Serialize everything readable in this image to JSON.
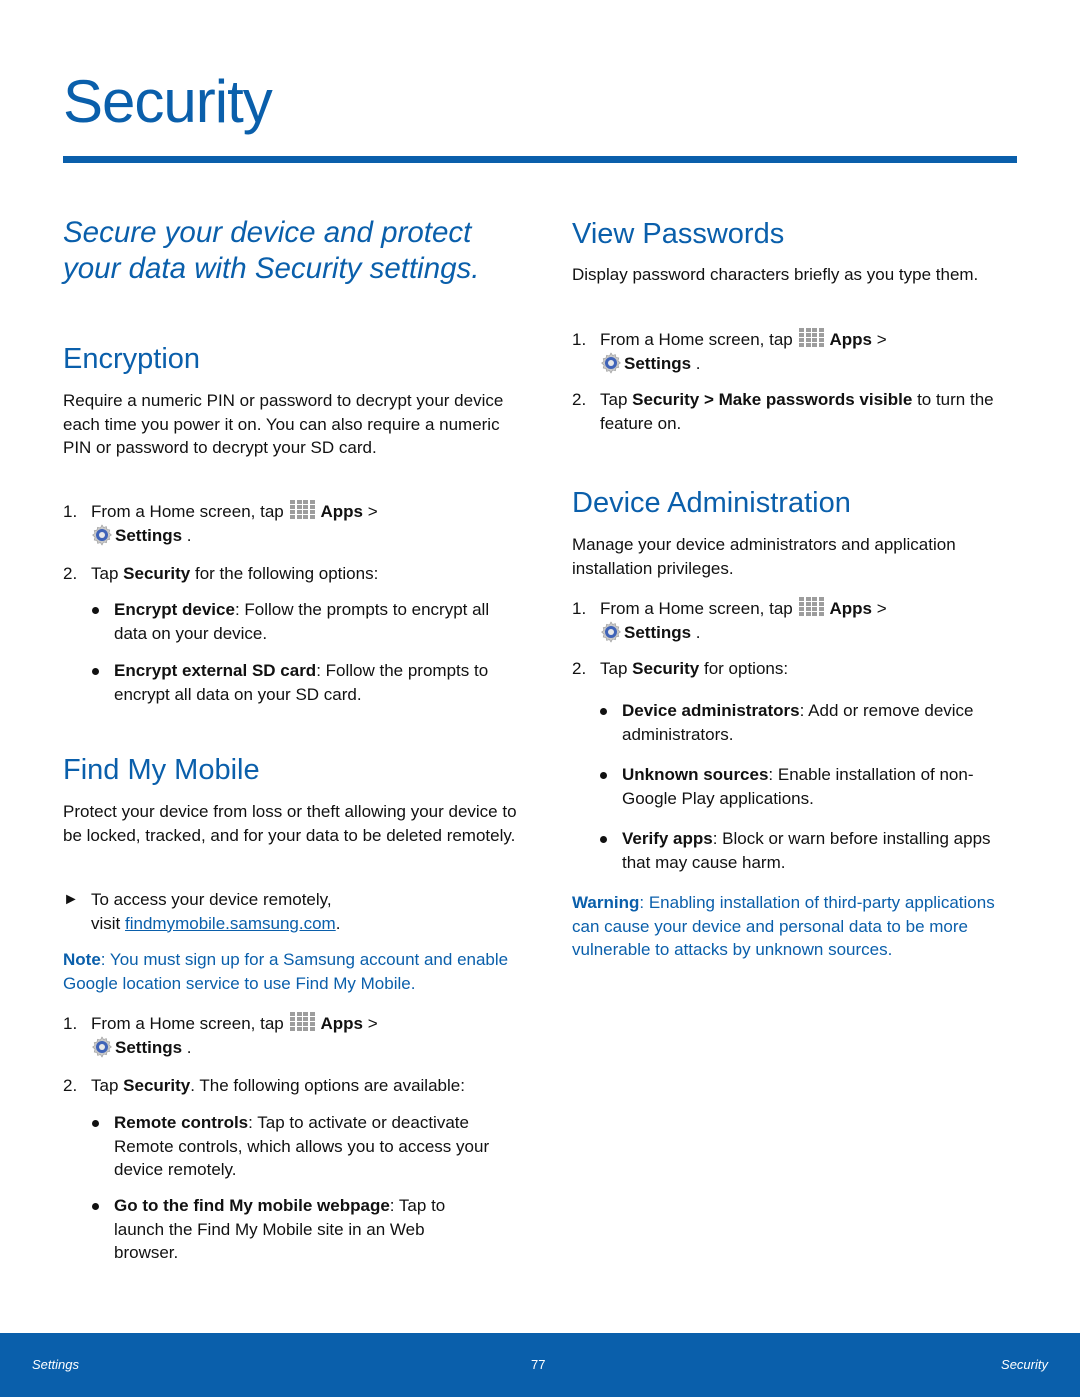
{
  "page": {
    "title": "Security",
    "intro": "Secure your device and protect your data with Security settings.",
    "accent_color": "#0a5fab"
  },
  "encryption": {
    "heading": "Encryption",
    "description": "Require a numeric PIN or password to decrypt your device each time you power it on. You can also require a numeric PIN or password to decrypt your SD card.",
    "steps": [
      {
        "num": "1.",
        "pre": "From a Home screen, tap",
        "apps": "Apps",
        "sep": ">",
        "settings": "Settings",
        "post": "."
      },
      {
        "num": "2.",
        "pre": "Tap",
        "bold": "Security",
        "post": "for the following options:"
      }
    ],
    "bullets": [
      {
        "term": "Encrypt device",
        "text": ": Follow the prompts to encrypt all data on your device."
      },
      {
        "term": "Encrypt external SD card",
        "text": ": Follow the prompts to encrypt all data on your SD card."
      }
    ]
  },
  "find_my_mobile": {
    "heading": "Find My Mobile",
    "description": "Protect your device from loss or theft allowing your device to be locked, tracked, and for your data to be deleted remotely.",
    "access": {
      "arrow": "►",
      "line1": "To access your device remotely,",
      "visit": "visit",
      "link": "findmymobile.samsung.com",
      "end": "."
    },
    "note": {
      "label": "Note",
      "text": ": You must sign up for a Samsung account and enable Google location service to use Find My Mobile."
    },
    "steps": [
      {
        "num": "1.",
        "pre": "From a Home screen, tap",
        "apps": "Apps",
        "sep": ">",
        "settings": "Settings",
        "post": "."
      },
      {
        "num": "2.",
        "pre": "Tap",
        "bold": "Security",
        "post": ". The following options are available:"
      }
    ],
    "bullets": [
      {
        "term": "Remote controls",
        "text": ": Tap to activate or deactivate Remote controls, which allows you to access your device remotely."
      },
      {
        "term": "Go to the find My mobile webpage",
        "text": ": Tap to launch the Find My Mobile site in an Web browser."
      }
    ]
  },
  "view_passwords": {
    "heading": "View Passwords",
    "description": "Display password characters briefly as you type them.",
    "steps": [
      {
        "num": "1.",
        "pre": "From a Home screen, tap",
        "apps": "Apps",
        "sep": ">",
        "settings": "Settings",
        "post": "."
      },
      {
        "num": "2.",
        "pre": "Tap",
        "bold": "Security > Make passwords visible",
        "post": "to turn the feature on."
      }
    ]
  },
  "device_admin": {
    "heading": "Device Administration",
    "description": "Manage your device administrators and application installation privileges.",
    "steps": [
      {
        "num": "1.",
        "pre": "From a Home screen, tap",
        "apps": "Apps",
        "sep": ">",
        "settings": "Settings",
        "post": "."
      },
      {
        "num": "2.",
        "pre": "Tap",
        "bold": "Security",
        "post": "for options:"
      }
    ],
    "bullets": [
      {
        "term": "Device administrators",
        "text": ": Add or remove device administrators."
      },
      {
        "term": "Unknown sources",
        "text": ": Enable installation of non-Google Play applications."
      },
      {
        "term": "Verify apps",
        "text": ": Block or warn before installing apps that may cause harm."
      }
    ],
    "warning": {
      "label": "Warning",
      "text": ": Enabling installation of third-party applications can cause your device and personal data to be more vulnerable to attacks by unknown sources."
    }
  },
  "footer": {
    "left": "Settings",
    "page_number": "77",
    "right": "Security"
  }
}
